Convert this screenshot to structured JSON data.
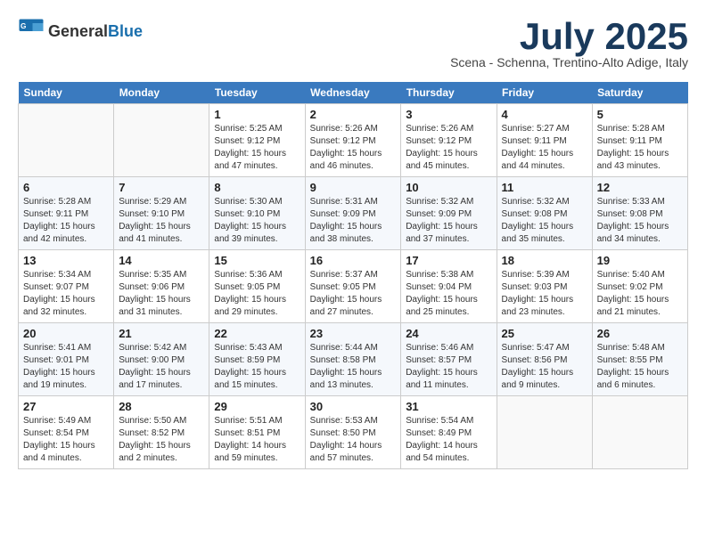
{
  "logo": {
    "general": "General",
    "blue": "Blue"
  },
  "title": "July 2025",
  "subtitle": "Scena - Schenna, Trentino-Alto Adige, Italy",
  "days_of_week": [
    "Sunday",
    "Monday",
    "Tuesday",
    "Wednesday",
    "Thursday",
    "Friday",
    "Saturday"
  ],
  "weeks": [
    [
      {
        "num": "",
        "info": ""
      },
      {
        "num": "",
        "info": ""
      },
      {
        "num": "1",
        "info": "Sunrise: 5:25 AM\nSunset: 9:12 PM\nDaylight: 15 hours and 47 minutes."
      },
      {
        "num": "2",
        "info": "Sunrise: 5:26 AM\nSunset: 9:12 PM\nDaylight: 15 hours and 46 minutes."
      },
      {
        "num": "3",
        "info": "Sunrise: 5:26 AM\nSunset: 9:12 PM\nDaylight: 15 hours and 45 minutes."
      },
      {
        "num": "4",
        "info": "Sunrise: 5:27 AM\nSunset: 9:11 PM\nDaylight: 15 hours and 44 minutes."
      },
      {
        "num": "5",
        "info": "Sunrise: 5:28 AM\nSunset: 9:11 PM\nDaylight: 15 hours and 43 minutes."
      }
    ],
    [
      {
        "num": "6",
        "info": "Sunrise: 5:28 AM\nSunset: 9:11 PM\nDaylight: 15 hours and 42 minutes."
      },
      {
        "num": "7",
        "info": "Sunrise: 5:29 AM\nSunset: 9:10 PM\nDaylight: 15 hours and 41 minutes."
      },
      {
        "num": "8",
        "info": "Sunrise: 5:30 AM\nSunset: 9:10 PM\nDaylight: 15 hours and 39 minutes."
      },
      {
        "num": "9",
        "info": "Sunrise: 5:31 AM\nSunset: 9:09 PM\nDaylight: 15 hours and 38 minutes."
      },
      {
        "num": "10",
        "info": "Sunrise: 5:32 AM\nSunset: 9:09 PM\nDaylight: 15 hours and 37 minutes."
      },
      {
        "num": "11",
        "info": "Sunrise: 5:32 AM\nSunset: 9:08 PM\nDaylight: 15 hours and 35 minutes."
      },
      {
        "num": "12",
        "info": "Sunrise: 5:33 AM\nSunset: 9:08 PM\nDaylight: 15 hours and 34 minutes."
      }
    ],
    [
      {
        "num": "13",
        "info": "Sunrise: 5:34 AM\nSunset: 9:07 PM\nDaylight: 15 hours and 32 minutes."
      },
      {
        "num": "14",
        "info": "Sunrise: 5:35 AM\nSunset: 9:06 PM\nDaylight: 15 hours and 31 minutes."
      },
      {
        "num": "15",
        "info": "Sunrise: 5:36 AM\nSunset: 9:05 PM\nDaylight: 15 hours and 29 minutes."
      },
      {
        "num": "16",
        "info": "Sunrise: 5:37 AM\nSunset: 9:05 PM\nDaylight: 15 hours and 27 minutes."
      },
      {
        "num": "17",
        "info": "Sunrise: 5:38 AM\nSunset: 9:04 PM\nDaylight: 15 hours and 25 minutes."
      },
      {
        "num": "18",
        "info": "Sunrise: 5:39 AM\nSunset: 9:03 PM\nDaylight: 15 hours and 23 minutes."
      },
      {
        "num": "19",
        "info": "Sunrise: 5:40 AM\nSunset: 9:02 PM\nDaylight: 15 hours and 21 minutes."
      }
    ],
    [
      {
        "num": "20",
        "info": "Sunrise: 5:41 AM\nSunset: 9:01 PM\nDaylight: 15 hours and 19 minutes."
      },
      {
        "num": "21",
        "info": "Sunrise: 5:42 AM\nSunset: 9:00 PM\nDaylight: 15 hours and 17 minutes."
      },
      {
        "num": "22",
        "info": "Sunrise: 5:43 AM\nSunset: 8:59 PM\nDaylight: 15 hours and 15 minutes."
      },
      {
        "num": "23",
        "info": "Sunrise: 5:44 AM\nSunset: 8:58 PM\nDaylight: 15 hours and 13 minutes."
      },
      {
        "num": "24",
        "info": "Sunrise: 5:46 AM\nSunset: 8:57 PM\nDaylight: 15 hours and 11 minutes."
      },
      {
        "num": "25",
        "info": "Sunrise: 5:47 AM\nSunset: 8:56 PM\nDaylight: 15 hours and 9 minutes."
      },
      {
        "num": "26",
        "info": "Sunrise: 5:48 AM\nSunset: 8:55 PM\nDaylight: 15 hours and 6 minutes."
      }
    ],
    [
      {
        "num": "27",
        "info": "Sunrise: 5:49 AM\nSunset: 8:54 PM\nDaylight: 15 hours and 4 minutes."
      },
      {
        "num": "28",
        "info": "Sunrise: 5:50 AM\nSunset: 8:52 PM\nDaylight: 15 hours and 2 minutes."
      },
      {
        "num": "29",
        "info": "Sunrise: 5:51 AM\nSunset: 8:51 PM\nDaylight: 14 hours and 59 minutes."
      },
      {
        "num": "30",
        "info": "Sunrise: 5:53 AM\nSunset: 8:50 PM\nDaylight: 14 hours and 57 minutes."
      },
      {
        "num": "31",
        "info": "Sunrise: 5:54 AM\nSunset: 8:49 PM\nDaylight: 14 hours and 54 minutes."
      },
      {
        "num": "",
        "info": ""
      },
      {
        "num": "",
        "info": ""
      }
    ]
  ]
}
